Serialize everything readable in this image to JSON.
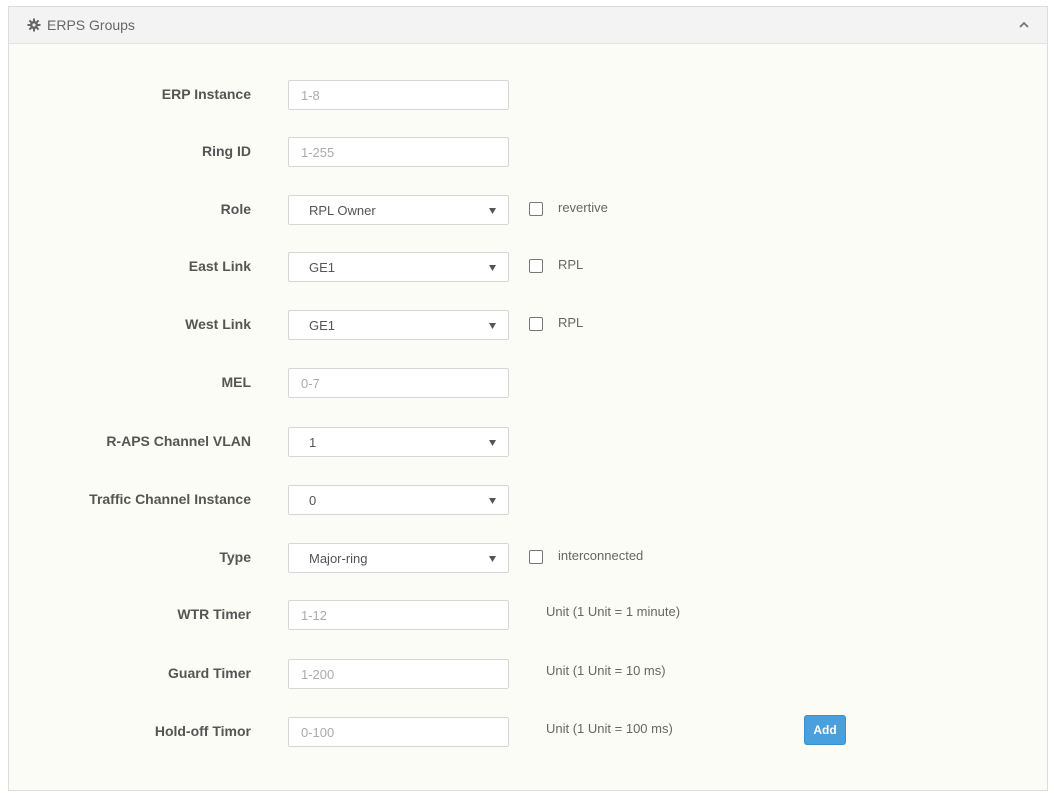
{
  "panel": {
    "title": "ERPS Groups",
    "header_icon": "gear-icon",
    "collapse_icon": "chevron-up-icon"
  },
  "form": {
    "erp_instance": {
      "label": "ERP Instance",
      "value": "",
      "placeholder": "1-8"
    },
    "ring_id": {
      "label": "Ring ID",
      "value": "",
      "placeholder": "1-255"
    },
    "role": {
      "label": "Role",
      "selected": "RPL Owner",
      "checkbox_label": "revertive",
      "checked": false
    },
    "east_link": {
      "label": "East Link",
      "selected": "GE1",
      "checkbox_label": "RPL",
      "checked": false
    },
    "west_link": {
      "label": "West Link",
      "selected": "GE1",
      "checkbox_label": "RPL",
      "checked": false
    },
    "mel": {
      "label": "MEL",
      "value": "",
      "placeholder": "0-7"
    },
    "raps_vlan": {
      "label": "R-APS Channel VLAN",
      "selected": "1"
    },
    "traffic_instance": {
      "label": "Traffic Channel Instance",
      "selected": "0"
    },
    "type": {
      "label": "Type",
      "selected": "Major-ring",
      "checkbox_label": "interconnected",
      "checked": false
    },
    "wtr_timer": {
      "label": "WTR Timer",
      "value": "",
      "placeholder": "1-12",
      "unit": "Unit (1 Unit = 1 minute)"
    },
    "guard_timer": {
      "label": "Guard Timer",
      "value": "",
      "placeholder": "1-200",
      "unit": "Unit (1 Unit = 10 ms)"
    },
    "holdoff_timer": {
      "label": "Hold-off Timor",
      "value": "",
      "placeholder": "0-100",
      "unit": "Unit (1 Unit = 100 ms)"
    }
  },
  "actions": {
    "add_label": "Add"
  },
  "colors": {
    "accent": "#4aa0dc",
    "panel_bg": "#fcfcf6",
    "header_bg": "#f3f3f3"
  }
}
